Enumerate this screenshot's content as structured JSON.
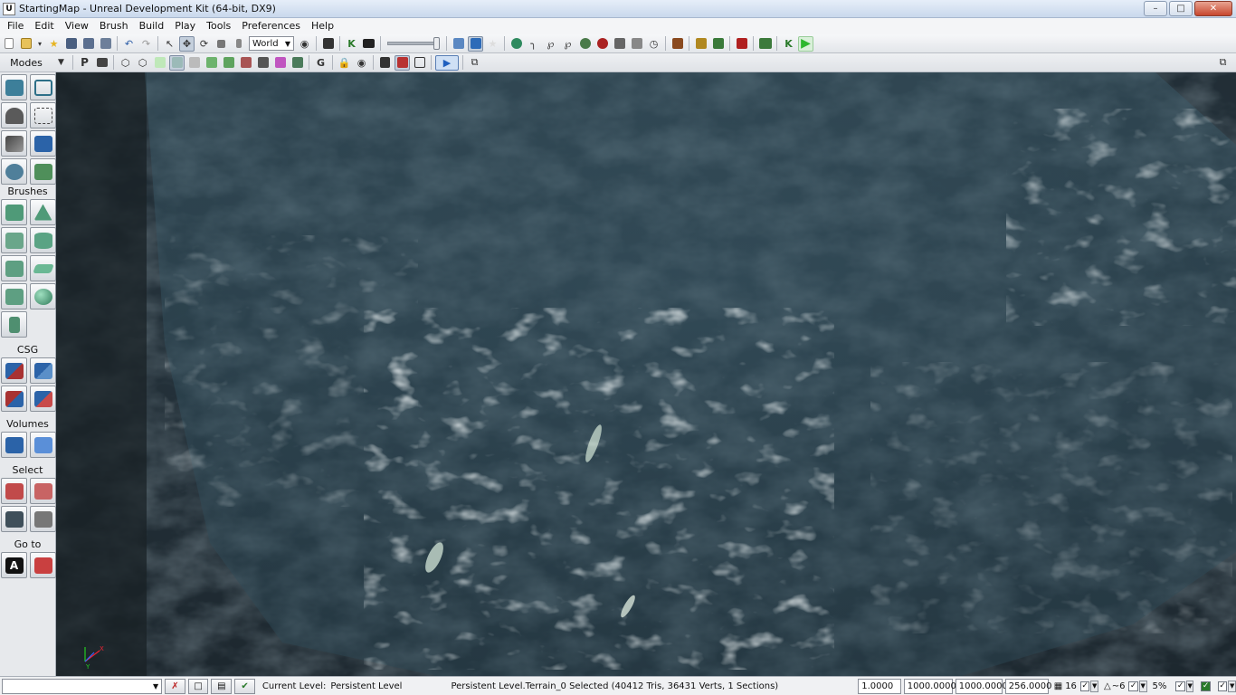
{
  "window": {
    "title": "StartingMap - Unreal Development Kit (64-bit, DX9)",
    "app_icon": "U"
  },
  "menu": [
    "File",
    "Edit",
    "View",
    "Brush",
    "Build",
    "Play",
    "Tools",
    "Preferences",
    "Help"
  ],
  "toolbar1": {
    "coord_system": "World"
  },
  "toolbar2": {
    "modes_label": "Modes",
    "p_label": "P",
    "g_label": "G"
  },
  "modes_panel": {
    "sections": {
      "brushes": "Brushes",
      "csg": "CSG",
      "volumes": "Volumes",
      "select": "Select",
      "goto": "Go to"
    },
    "goto_a_label": "A"
  },
  "viewport": {
    "description_hidden": "",
    "axis": {
      "x": "X",
      "y": "Y"
    }
  },
  "statusbar": {
    "level_label": "Current Level:",
    "level_value": "Persistent Level",
    "selection_text": "Persistent Level.Terrain_0 Selected (40412 Tris, 36431 Verts, 1 Sections)",
    "drag_grid": "1.0000",
    "value_2": "1000.0000",
    "value_3": "1000.0000",
    "value_4": "256.0000",
    "grid_size": "16",
    "rotation_snap": "~6",
    "scale_snap": "5%"
  },
  "colors": {
    "terrain_dark": "#1f2b33",
    "terrain_mid": "#2b3d47",
    "water_tint": "#3a5766",
    "snow": "#c9d3d6",
    "play_green": "#2eb82e"
  }
}
